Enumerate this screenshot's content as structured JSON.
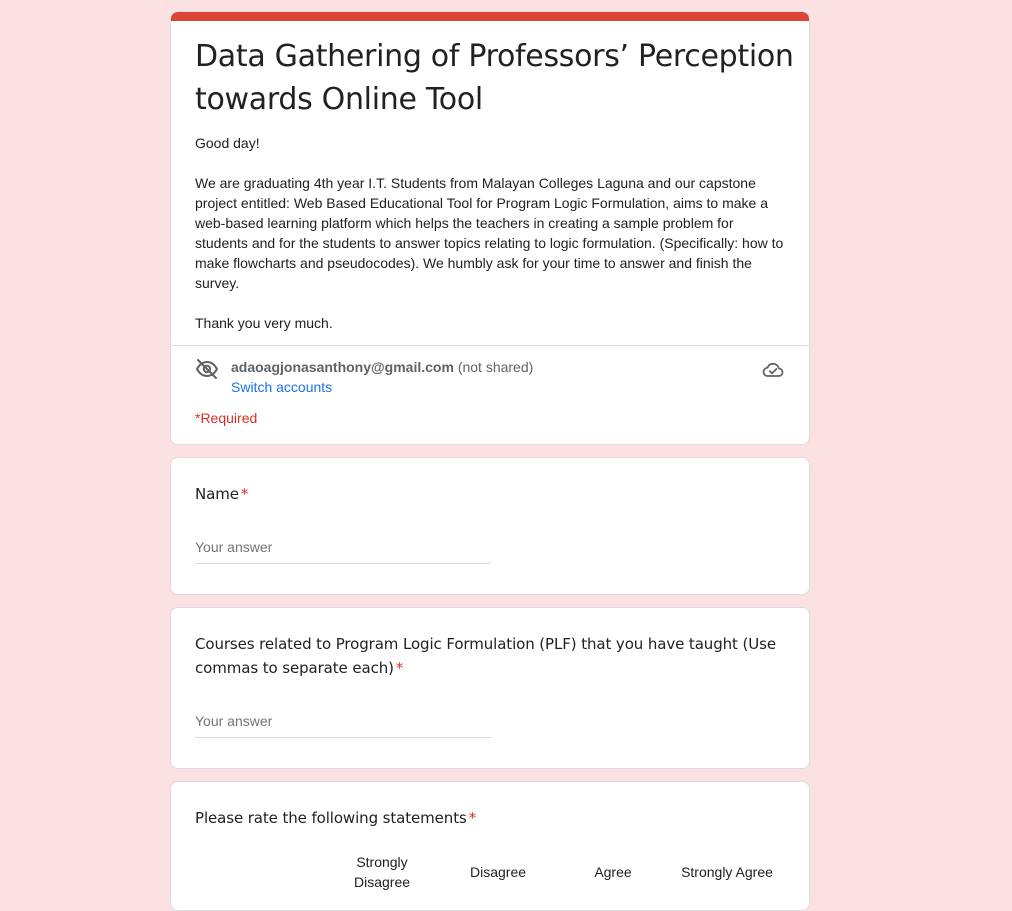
{
  "header": {
    "accent_color": "#db4437",
    "title": "Data Gathering of Professors’ Perception towards Online Tool",
    "description": [
      "Good day!",
      "We are graduating 4th year I.T. Students from Malayan Colleges Laguna and our capstone project entitled: Web Based Educational Tool for Program Logic Formulation, aims to make a web-based learning platform which helps the teachers in creating a sample problem for students and for the students to answer topics relating to logic formulation. (Specifically: how to make flowcharts and pseudocodes). We humbly ask for your time to answer and finish the survey.",
      "Thank you very much."
    ],
    "account": {
      "email": "adaoagjonasanthony@gmail.com",
      "not_shared": "(not shared)",
      "switch_label": "Switch accounts",
      "visibility_icon": "eye-off-icon",
      "save_status_icon": "cloud-check-icon"
    },
    "required_note": "*Required"
  },
  "questions": [
    {
      "label": "Name",
      "required_mark": "*",
      "placeholder": "Your answer"
    },
    {
      "label": "Courses related to Program Logic Formulation (PLF) that you have taught (Use commas to separate each)",
      "required_mark": "*",
      "placeholder": "Your answer"
    },
    {
      "label": "Please rate the following statements",
      "required_mark": "*",
      "columns": [
        "Strongly Disagree",
        "Disagree",
        "Agree",
        "Strongly Agree"
      ]
    }
  ],
  "colors": {
    "background": "#fbe1e1",
    "required": "#d93025",
    "link": "#1a73e8"
  }
}
